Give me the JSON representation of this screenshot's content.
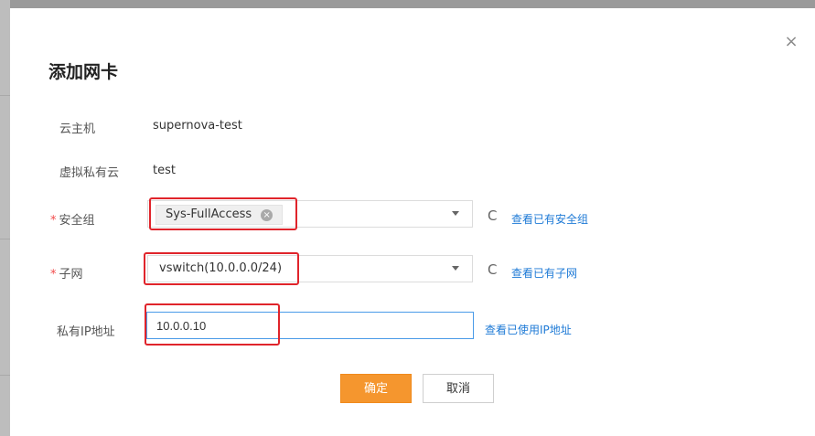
{
  "dialog": {
    "title": "添加网卡",
    "close_symbol": "×"
  },
  "fields": {
    "host": {
      "label": "云主机",
      "value": "supernova-test"
    },
    "vpc": {
      "label": "虚拟私有云",
      "value": "test"
    },
    "security_group": {
      "required_mark": "*",
      "label": "安全组",
      "selected_tag": "Sys-FullAccess",
      "remove_symbol": "×",
      "refresh_symbol": "C",
      "link": "查看已有安全组"
    },
    "subnet": {
      "required_mark": "*",
      "label": "子网",
      "selected": "vswitch(10.0.0.0/24)",
      "refresh_symbol": "C",
      "link": "查看已有子网"
    },
    "private_ip": {
      "label": "私有IP地址",
      "value": "10.0.0.10",
      "link": "查看已使用IP地址"
    }
  },
  "buttons": {
    "confirm": "确定",
    "cancel": "取消"
  },
  "colors": {
    "highlight": "#e0242b",
    "primary_button": "#f5962e",
    "link": "#1e7ad6",
    "required": "#f24b4b"
  },
  "icons": {
    "close": "close-icon",
    "refresh": "refresh-icon",
    "dropdown": "chevron-down-icon",
    "tag_remove": "remove-tag-icon"
  }
}
